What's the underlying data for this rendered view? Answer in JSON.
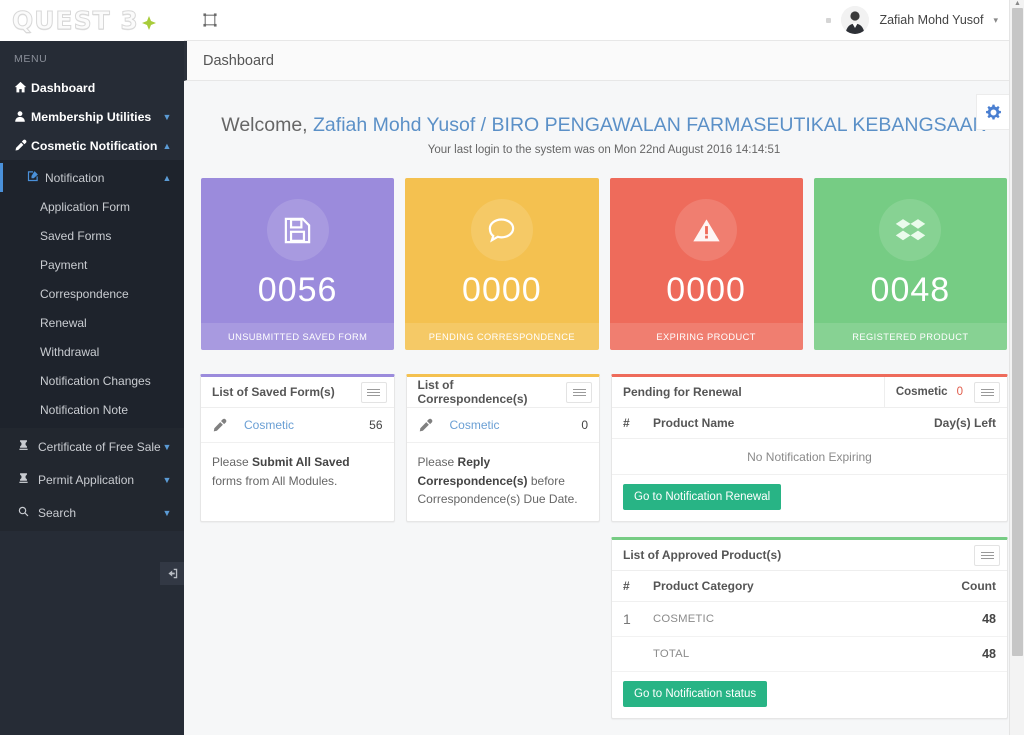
{
  "brand": {
    "logo_text": "QUEST 3",
    "logo_mark": "green-diamond-icon"
  },
  "sidebar": {
    "menu_label": "MENU",
    "items": [
      {
        "label": "Dashboard",
        "icon": "home-icon",
        "caret": ""
      },
      {
        "label": "Membership Utilities",
        "icon": "user-icon",
        "caret": "▼"
      },
      {
        "label": "Cosmetic Notification",
        "icon": "pipette-icon",
        "caret": "▲"
      }
    ],
    "notification": {
      "label": "Notification",
      "icon": "edit-square-icon",
      "caret": "▲"
    },
    "sub_items": [
      {
        "label": "Application Form"
      },
      {
        "label": "Saved Forms"
      },
      {
        "label": "Payment"
      },
      {
        "label": "Correspondence"
      },
      {
        "label": "Renewal"
      },
      {
        "label": "Withdrawal"
      },
      {
        "label": "Notification Changes"
      },
      {
        "label": "Notification Note"
      }
    ],
    "lower_items": [
      {
        "label": "Certificate of Free Sale",
        "icon": "certificate-icon",
        "caret": "▼"
      },
      {
        "label": "Permit Application",
        "icon": "certificate-icon",
        "caret": "▼"
      },
      {
        "label": "Search",
        "icon": "search-icon",
        "caret": "▼"
      }
    ],
    "collapse_icon": "collapse-sidebar-icon"
  },
  "topbar": {
    "expand_icon": "expand-screen-icon",
    "user_name": "Zafiah Mohd Yusof",
    "user_caret": "▾",
    "avatar": "user-avatar"
  },
  "page": {
    "title": "Dashboard",
    "settings_icon": "gear-icon"
  },
  "welcome": {
    "prefix": "Welcome, ",
    "highlight": "Zafiah Mohd Yusof / BIRO PENGAWALAN FARMASEUTIKAL KEBANGSAAN",
    "last_login": "Your last login to the system was on Mon 22nd August 2016 14:14:51"
  },
  "stat_cards": [
    {
      "value": "0056",
      "label": "UNSUBMITTED SAVED FORM",
      "icon": "floppy-save-icon",
      "color": "#9b8bdc"
    },
    {
      "value": "0000",
      "label": "PENDING CORRESPONDENCE",
      "icon": "speech-bubble-icon",
      "color": "#f4c150"
    },
    {
      "value": "0000",
      "label": "EXPIRING PRODUCT",
      "icon": "warning-triangle-icon",
      "color": "#ee6b5b"
    },
    {
      "value": "0048",
      "label": "REGISTERED PRODUCT",
      "icon": "dropbox-box-icon",
      "color": "#76cc84"
    }
  ],
  "saved_forms_panel": {
    "title": "List of Saved Form(s)",
    "menu_icon": "hamburger-icon",
    "row": {
      "icon": "pipette-icon",
      "name": "Cosmetic",
      "value": "56"
    },
    "note_prefix": "Please ",
    "note_bold": "Submit All Saved",
    "note_suffix": " forms from All Modules."
  },
  "correspondence_panel": {
    "title": "List of Correspondence(s)",
    "menu_icon": "hamburger-icon",
    "row": {
      "icon": "pipette-icon",
      "name": "Cosmetic",
      "value": "0"
    },
    "note_prefix": "Please ",
    "note_bold": "Reply Correspondence(s)",
    "note_suffix": " before Correspondence(s) Due Date."
  },
  "renewal_panel": {
    "title": "Pending for Renewal",
    "badge_label": "Cosmetic",
    "badge_count": "0",
    "menu_icon": "hamburger-icon",
    "columns": {
      "hash": "#",
      "name": "Product Name",
      "right": "Day(s) Left"
    },
    "empty_text": "No Notification Expiring",
    "button": "Go to Notification Renewal"
  },
  "approved_panel": {
    "title": "List of Approved Product(s)",
    "menu_icon": "hamburger-icon",
    "columns": {
      "hash": "#",
      "name": "Product Category",
      "right": "Count"
    },
    "rows": [
      {
        "hash": "1",
        "name": "COSMETIC",
        "count": "48"
      },
      {
        "hash": "",
        "name": "TOTAL",
        "count": "48"
      }
    ],
    "button": "Go to Notification status"
  },
  "colors": {
    "sidebar_bg": "#262c36",
    "sidebar_sub_bg": "#1e232c",
    "accent_blue": "#4a90d9",
    "purple": "#9b8bdc",
    "yellow": "#f4c150",
    "red": "#ee6b5b",
    "green": "#76cc84",
    "button_green": "#28b485"
  }
}
